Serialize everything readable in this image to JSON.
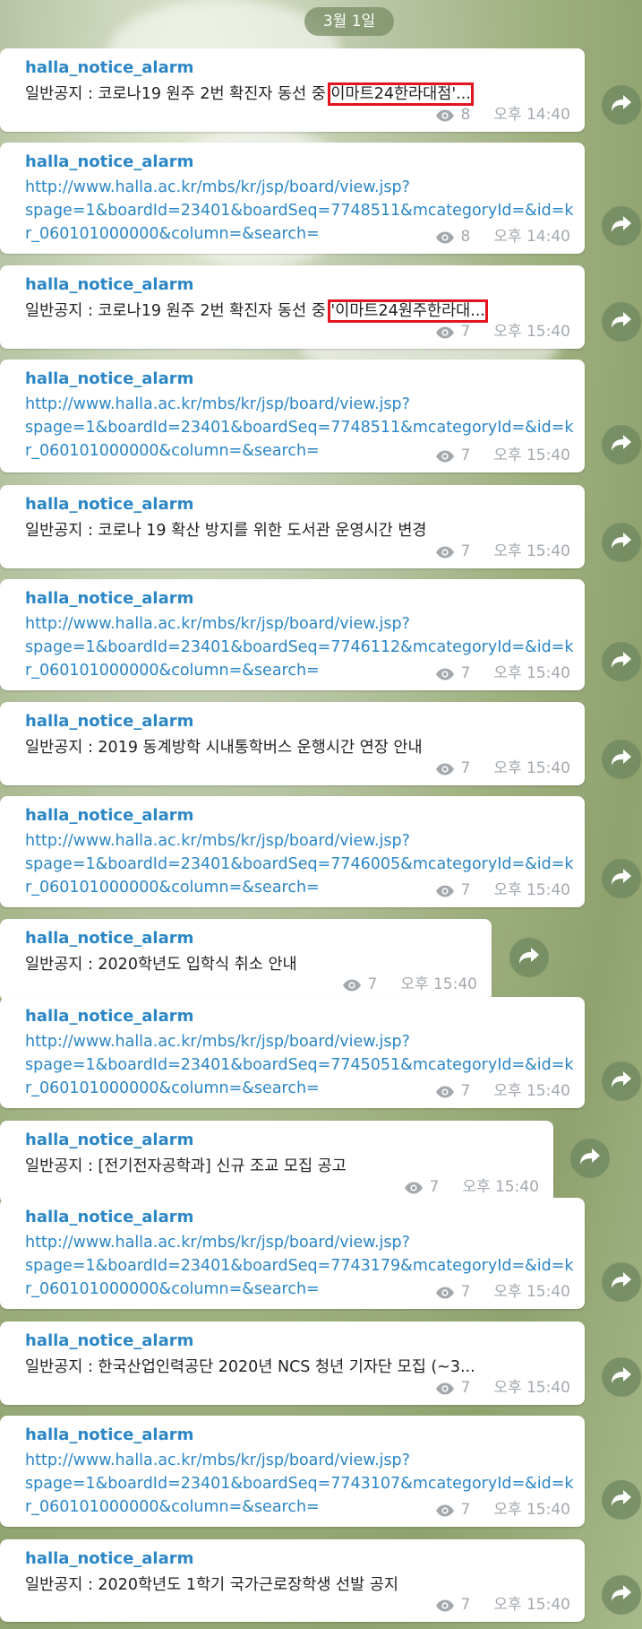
{
  "date_label": "3월 1일",
  "messages": [
    {
      "sender": "halla_notice_alarm",
      "body": "일반공지 : 코로나19 원주 2번 확진자 동선 중 ",
      "highlight": "이마트24한라대점'...",
      "views": "8",
      "time": "오후 14:40"
    },
    {
      "sender": "halla_notice_alarm",
      "link": [
        "http://www.halla.ac.kr/mbs/kr/jsp/board/view.jsp?",
        "spage=1&boardId=23401&boardSeq=7748511&mcategoryId=&id=k",
        "r_060101000000&column=&search="
      ],
      "views": "8",
      "time": "오후 14:40"
    },
    {
      "sender": "halla_notice_alarm",
      "body": "일반공지 : 코로나19 원주 2번 확진자 동선 중 ",
      "highlight": "'이마트24원주한라대...",
      "views": "7",
      "time": "오후 15:40"
    },
    {
      "sender": "halla_notice_alarm",
      "link": [
        "http://www.halla.ac.kr/mbs/kr/jsp/board/view.jsp?",
        "spage=1&boardId=23401&boardSeq=7748511&mcategoryId=&id=k",
        "r_060101000000&column=&search="
      ],
      "views": "7",
      "time": "오후 15:40"
    },
    {
      "sender": "halla_notice_alarm",
      "body": "일반공지 : 코로나 19 확산 방지를 위한 도서관 운영시간 변경",
      "views": "7",
      "time": "오후 15:40"
    },
    {
      "sender": "halla_notice_alarm",
      "link": [
        "http://www.halla.ac.kr/mbs/kr/jsp/board/view.jsp?",
        "spage=1&boardId=23401&boardSeq=7746112&mcategoryId=&id=k",
        "r_060101000000&column=&search="
      ],
      "views": "7",
      "time": "오후 15:40"
    },
    {
      "sender": "halla_notice_alarm",
      "body": "일반공지 : 2019 동계방학 시내통학버스 운행시간 연장 안내",
      "views": "7",
      "time": "오후 15:40"
    },
    {
      "sender": "halla_notice_alarm",
      "link": [
        "http://www.halla.ac.kr/mbs/kr/jsp/board/view.jsp?",
        "spage=1&boardId=23401&boardSeq=7746005&mcategoryId=&id=k",
        "r_060101000000&column=&search="
      ],
      "views": "7",
      "time": "오후 15:40"
    },
    {
      "sender": "halla_notice_alarm",
      "body": "일반공지 : 2020학년도 입학식 취소 안내",
      "views": "7",
      "time": "오후 15:40"
    },
    {
      "sender": "halla_notice_alarm",
      "link": [
        "http://www.halla.ac.kr/mbs/kr/jsp/board/view.jsp?",
        "spage=1&boardId=23401&boardSeq=7745051&mcategoryId=&id=k",
        "r_060101000000&column=&search="
      ],
      "views": "7",
      "time": "오후 15:40"
    },
    {
      "sender": "halla_notice_alarm",
      "body": "일반공지 : [전기전자공학과] 신규 조교 모집 공고",
      "views": "7",
      "time": "오후 15:40"
    },
    {
      "sender": "halla_notice_alarm",
      "link": [
        "http://www.halla.ac.kr/mbs/kr/jsp/board/view.jsp?",
        "spage=1&boardId=23401&boardSeq=7743179&mcategoryId=&id=k",
        "r_060101000000&column=&search="
      ],
      "views": "7",
      "time": "오후 15:40"
    },
    {
      "sender": "halla_notice_alarm",
      "body": "일반공지 : 한국산업인력공단 2020년 NCS 청년 기자단 모집 (~3...",
      "views": "7",
      "time": "오후 15:40"
    },
    {
      "sender": "halla_notice_alarm",
      "link": [
        "http://www.halla.ac.kr/mbs/kr/jsp/board/view.jsp?",
        "spage=1&boardId=23401&boardSeq=7743107&mcategoryId=&id=k",
        "r_060101000000&column=&search="
      ],
      "views": "7",
      "time": "오후 15:40"
    },
    {
      "sender": "halla_notice_alarm",
      "body": "일반공지 : 2020학년도 1학기 국가근로장학생 선발 공지",
      "views": "7",
      "time": "오후 15:40"
    }
  ],
  "icons": {
    "views": "eye-icon",
    "forward": "share-arrow-icon"
  },
  "colors": {
    "sender": "#2b86c5",
    "highlight_box": "#e3141f",
    "meta": "#a3a8ad"
  }
}
